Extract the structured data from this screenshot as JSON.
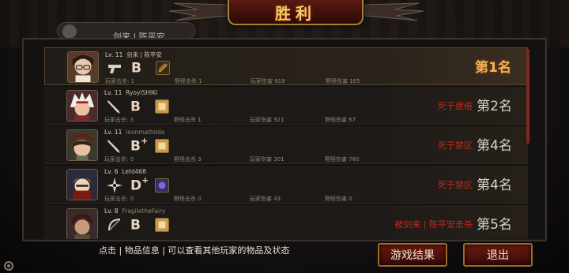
{
  "header": {
    "title": "胜利"
  },
  "top_pill": {
    "text": "剑来 | 陈平安"
  },
  "players": [
    {
      "level": "Lv. 11",
      "name": "剑来 | 陈平安",
      "grade": "B",
      "grade_plus": "",
      "weapon": "gun-icon",
      "item": "item-icon-bronze",
      "player_kills_label": "玩家击杀: 1",
      "monster_kills_label": "野怪击杀 1",
      "player_damage_label": "玩家伤害 919",
      "monster_damage_label": "野怪伤害 165",
      "death": "",
      "rank": "第1名"
    },
    {
      "level": "Lv. 11",
      "name": "RyoyiSHIKI",
      "grade": "B",
      "grade_plus": "",
      "weapon": "knife-icon",
      "item": "item-icon-gold",
      "player_kills_label": "玩家击杀: 3",
      "monster_kills_label": "野怪击杀 1",
      "player_damage_label": "玩家伤害 921",
      "monster_damage_label": "野怪伤害 67",
      "death": "死于疲倦",
      "rank": "第2名"
    },
    {
      "level": "Lv. 11",
      "name": "leonmathilda",
      "grade": "B",
      "grade_plus": "+",
      "weapon": "knife-icon",
      "item": "item-icon-gold",
      "player_kills_label": "玩家击杀: 0",
      "monster_kills_label": "野怪击杀 3",
      "player_damage_label": "玩家伤害 301",
      "monster_damage_label": "野怪伤害 780",
      "death": "死于禁区",
      "rank": "第4名"
    },
    {
      "level": "Lv. 6",
      "name": "Letd468",
      "grade": "D",
      "grade_plus": "+",
      "weapon": "shuriken-icon",
      "item": "item-icon-purple",
      "player_kills_label": "玩家击杀: 0",
      "monster_kills_label": "野怪击杀 0",
      "player_damage_label": "玩家伤害 43",
      "monster_damage_label": "野怪伤害 0",
      "death": "死于禁区",
      "rank": "第4名"
    },
    {
      "level": "Lv. 8",
      "name": "FragiletheFairy",
      "grade": "B",
      "grade_plus": "",
      "weapon": "bow-icon",
      "item": "item-icon-gold",
      "player_kills_label": "",
      "monster_kills_label": "",
      "player_damage_label": "",
      "monster_damage_label": "",
      "death_killer": "被剑来",
      "death_sep": "|",
      "death_killer2": "陈平安击杀",
      "rank": "第5名"
    }
  ],
  "footer": {
    "hint": "点击 | 物品信息 | 可以查看其他玩家的物品及状态",
    "results_button": "游戏结果",
    "exit_button": "退出"
  },
  "colors": {
    "accent_red": "#c6281c",
    "gold": "#f2b25a",
    "button_border": "#9a6a2a"
  }
}
